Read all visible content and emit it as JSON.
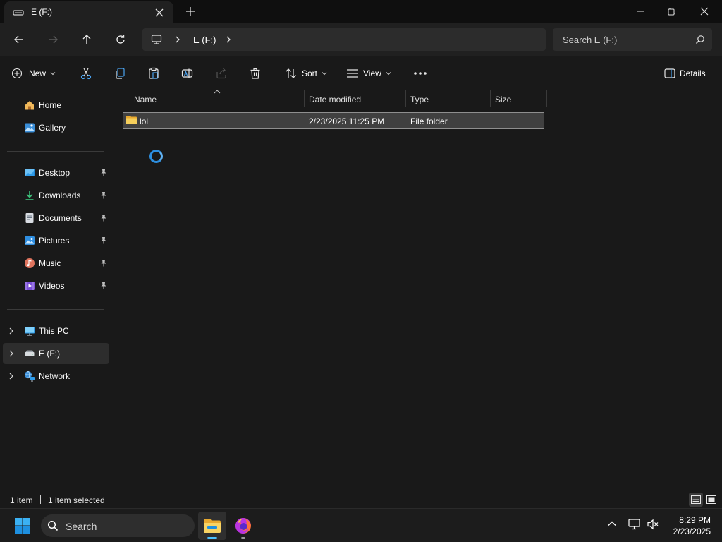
{
  "window": {
    "tab_title": "E (F:)",
    "accent": "#2d8fe0"
  },
  "nav": {
    "address_crumb": "E (F:)",
    "search_placeholder": "Search E (F:)"
  },
  "commands": {
    "new_label": "New",
    "sort_label": "Sort",
    "view_label": "View",
    "details_label": "Details"
  },
  "sidebar": {
    "quick": [
      {
        "label": "Home",
        "icon": "home-icon"
      },
      {
        "label": "Gallery",
        "icon": "gallery-icon"
      }
    ],
    "pinned": [
      {
        "label": "Desktop",
        "icon": "desktop-icon"
      },
      {
        "label": "Downloads",
        "icon": "downloads-icon"
      },
      {
        "label": "Documents",
        "icon": "documents-icon"
      },
      {
        "label": "Pictures",
        "icon": "pictures-icon"
      },
      {
        "label": "Music",
        "icon": "music-icon"
      },
      {
        "label": "Videos",
        "icon": "videos-icon"
      }
    ],
    "locations": [
      {
        "label": "This PC",
        "icon": "this-pc-icon"
      },
      {
        "label": "E (F:)",
        "icon": "drive-icon",
        "selected": true
      },
      {
        "label": "Network",
        "icon": "network-icon"
      }
    ]
  },
  "table": {
    "columns": [
      "Name",
      "Date modified",
      "Type",
      "Size"
    ],
    "rows": [
      {
        "name": "lol",
        "date": "2/23/2025 11:25 PM",
        "type": "File folder",
        "size": "",
        "selected": true
      }
    ]
  },
  "status": {
    "count": "1 item",
    "selection": "1 item selected"
  },
  "taskbar": {
    "search_label": "Search",
    "time": "8:29 PM",
    "date": "2/23/2025"
  }
}
